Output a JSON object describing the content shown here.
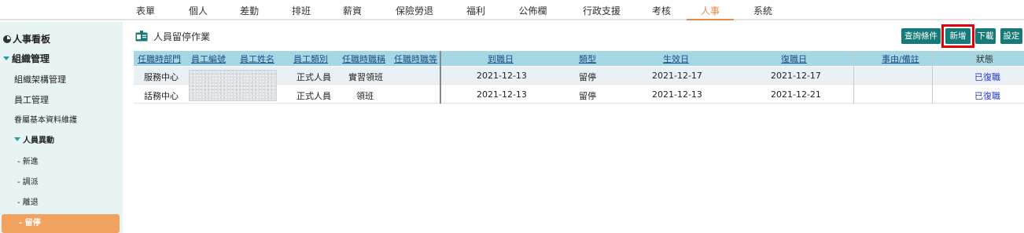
{
  "topnav": {
    "items": [
      "表單",
      "個人",
      "差勤",
      "排班",
      "薪資",
      "保險勞退",
      "福利",
      "公佈欄",
      "行政支援",
      "考核",
      "人事",
      "系統"
    ],
    "active": "人事",
    "accent": "#e8894a"
  },
  "sidebar": {
    "dashboard": "人事看板",
    "org_mgmt": "組織管理",
    "org_chart": "組織架構管理",
    "employee_mgmt": "員工管理",
    "basic_data": "眷屬基本資料維護",
    "personnel_changes": "人員異動",
    "new_hire": "- 新進",
    "transfer": "- 調派",
    "resign": "- 離退",
    "suspend": "- 留停",
    "bg_color": "#e8f4f4",
    "active_color": "#f0a25e"
  },
  "page": {
    "title": "人員留停作業",
    "icon": "id-card-icon"
  },
  "toolbar": {
    "query": "查詢條件",
    "add": "新增",
    "download": "下載",
    "settings": "設定",
    "button_color": "#177a78",
    "highlight_color": "#e0000a"
  },
  "table": {
    "headers": {
      "dept": "任職時部門",
      "emp_no": "員工編號",
      "emp_name": "員工姓名",
      "emp_type": "員工類別",
      "title": "任職時職稱",
      "grade": "任職時職等",
      "arrive": "到職日",
      "type": "類型",
      "effective": "生效日",
      "return": "復職日",
      "reason": "事由/備註",
      "status": "狀態"
    },
    "rows": [
      {
        "dept": "服務中心",
        "emp_type": "正式人員",
        "title": "實習領班",
        "grade": "",
        "arrive": "2021-12-13",
        "type": "留停",
        "effective": "2021-12-17",
        "return": "2021-12-17",
        "reason": "",
        "status": "已復職"
      },
      {
        "dept": "話務中心",
        "emp_type": "正式人員",
        "title": "領班",
        "grade": "",
        "arrive": "2021-12-13",
        "type": "留停",
        "effective": "2021-12-13",
        "return": "2021-12-21",
        "reason": "",
        "status": "已復職"
      }
    ],
    "header_bg": "#a7d7e3",
    "link_color": "#2a3ad0"
  }
}
